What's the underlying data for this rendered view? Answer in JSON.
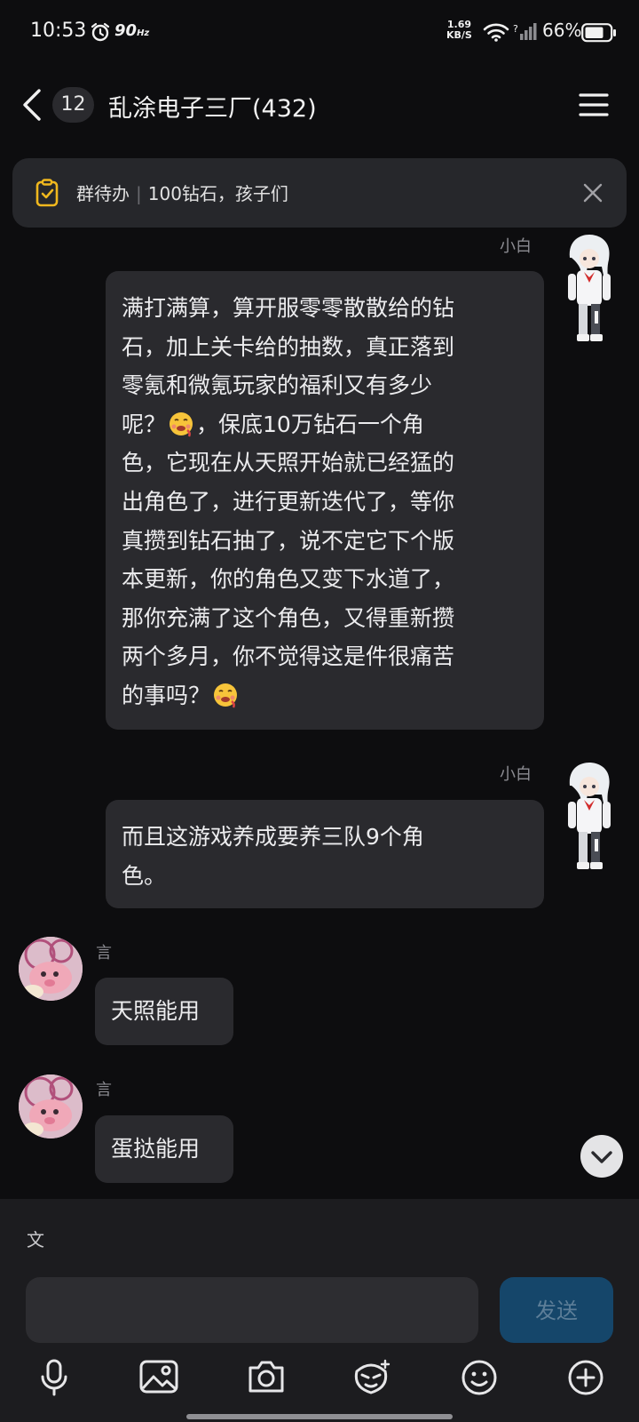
{
  "status_bar": {
    "time": "10:53",
    "refresh_rate": "90",
    "refresh_unit": "Hz",
    "net_speed_value": "1.69",
    "net_speed_unit": "KB/S",
    "battery": "66%"
  },
  "header": {
    "unread_count": "12",
    "title": "乱涂电子三厂(432)"
  },
  "todo_banner": {
    "label": "群待办",
    "text": "100钻石，孩子们"
  },
  "messages": [
    {
      "sender": "小白",
      "is_self": true,
      "lines": [
        "满打满算，算开服零零散散给的钻",
        "石，加上关卡给的抽数，真正落到",
        "零氪和微氪玩家的福利又有多少",
        "呢？",
        "，保底10万钻石一个角",
        "色，它现在从天照开始就已经猛的",
        "出角色了，进行更新迭代了，等你",
        "真攒到钻石抽了，说不定它下个版",
        "本更新，你的角色又变下水道了，",
        "那你充满了这个角色，又得重新攒",
        "两个多月，你不觉得这是件很痛苦",
        "的事吗？"
      ]
    },
    {
      "sender": "小白",
      "is_self": true,
      "lines": [
        "而且这游戏养成要养三队9个角",
        "色。"
      ]
    },
    {
      "sender": "言",
      "is_self": false,
      "text": "天照能用"
    },
    {
      "sender": "言",
      "is_self": false,
      "text": "蛋挞能用"
    }
  ],
  "input": {
    "translate_icon_label": "文",
    "placeholder": "",
    "send_label": "发送"
  },
  "icons": {
    "back": "chevron-left-icon",
    "menu": "menu-icon",
    "todo": "clipboard-check-icon",
    "close": "close-icon",
    "scroll_down": "chevron-down-icon",
    "toolbar": [
      "microphone-icon",
      "image-icon",
      "camera-icon",
      "sticker-icon",
      "emoji-icon",
      "plus-circle-icon"
    ]
  },
  "colors": {
    "background": "#0d0d0f",
    "bubble": "#2a2a2e",
    "send_button": "#15466a",
    "todo_icon": "#f0b81e"
  }
}
